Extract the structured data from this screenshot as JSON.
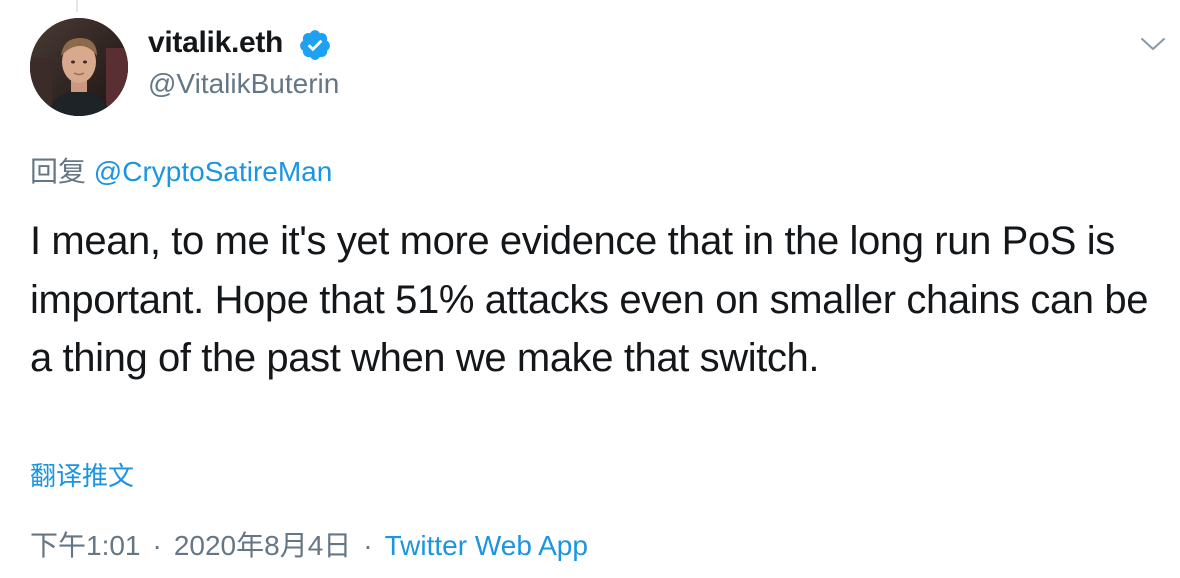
{
  "author": {
    "display_name": "vitalik.eth",
    "handle": "@VitalikButerin",
    "verified": true
  },
  "reply": {
    "prefix": "回复",
    "mention": "@CryptoSatireMan"
  },
  "tweet": {
    "text": "I mean, to me it's yet more evidence that in the long run PoS is important. Hope that 51% attacks even on smaller chains can be a thing of the past when we make that switch."
  },
  "translate_label": "翻译推文",
  "meta": {
    "time": "下午1:01",
    "separator": "·",
    "date": "2020年8月4日",
    "source": "Twitter Web App"
  },
  "colors": {
    "text": "#14171a",
    "secondary": "#657786",
    "link": "#1b95e0",
    "verified_badge": "#1da1f2"
  },
  "icons": {
    "verified": "verified-badge-icon",
    "menu": "chevron-down-icon"
  }
}
